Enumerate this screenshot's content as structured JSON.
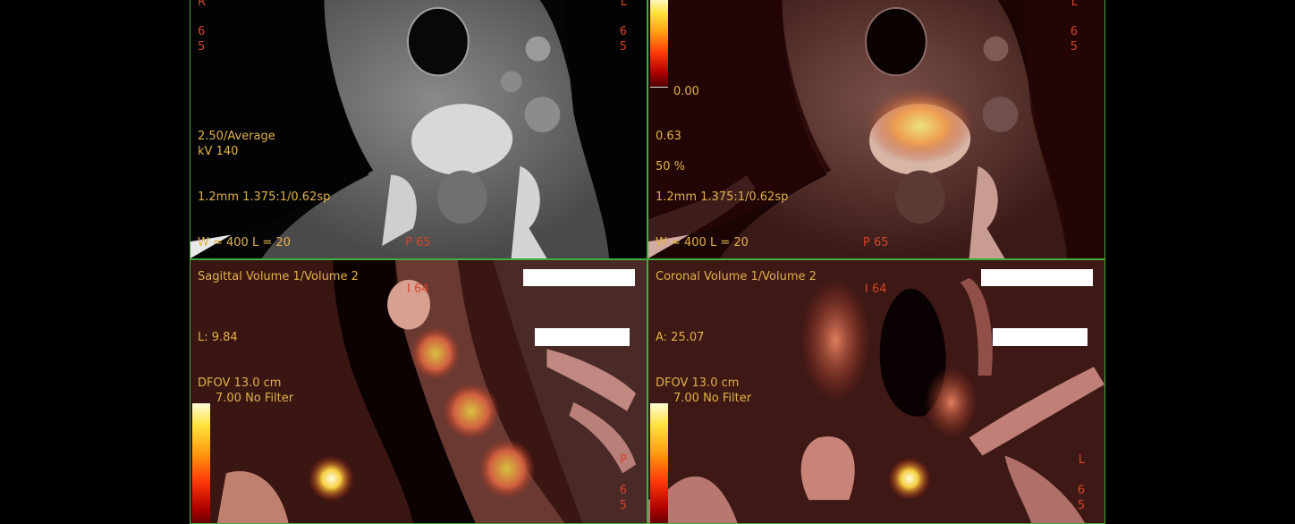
{
  "viewports": {
    "ct": {
      "orient_top_left": "R",
      "orient_top_right": "L",
      "side_left": [
        "6",
        "5"
      ],
      "side_right": [
        "6",
        "5"
      ],
      "thickness": "2.50/Average",
      "kv": "kV 140",
      "recon": "1.2mm 1.375:1/0.62sp",
      "window": "W = 400 L = 20",
      "bottom_orient": "P 65"
    },
    "fused": {
      "orient_top_right": "L",
      "side_right": [
        "6",
        "5"
      ],
      "scale_min": "0.00",
      "scale_value": "0.63",
      "blend": "50 %",
      "recon": "1.2mm 1.375:1/0.62sp",
      "window": "W = 400 L = 20",
      "bottom_orient": "P 65"
    },
    "sagittal": {
      "title": "Sagittal Volume 1/Volume 2",
      "top_orient": "I 64",
      "position": "L: 9.84",
      "dfov": "DFOV 13.0 cm",
      "filter": "7.00 No Filter",
      "right_orient": "P",
      "side_right": [
        "6",
        "5"
      ]
    },
    "coronal": {
      "title": "Coronal Volume 1/Volume 2",
      "top_orient": "I 64",
      "position": "A: 25.07",
      "dfov": "DFOV 13.0 cm",
      "filter": "7.00 No Filter",
      "right_orient": "L",
      "side_right": [
        "6",
        "5"
      ]
    }
  },
  "colors": {
    "border": "#3fae3f",
    "annotation": "#e0b14a",
    "orientation": "#d4442a"
  }
}
